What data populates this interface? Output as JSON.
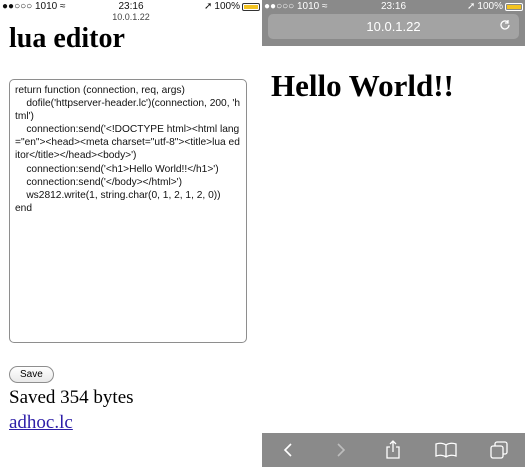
{
  "left": {
    "status": {
      "carrier": "●●○○○ 1010 ≈",
      "time": "23:16",
      "battery_text": "100%",
      "battery_level": 1.0
    },
    "small_url": "10.0.1.22",
    "title": "lua editor",
    "editor_text": "return function (connection, req, args)\n    dofile('httpserver-header.lc')(connection, 200, 'html')\n    connection:send('<!DOCTYPE html><html lang=\"en\"><head><meta charset=\"utf-8\"><title>lua editor</title></head><body>')\n    connection:send('<h1>Hello World!!</h1>')\n    connection:send('</body></html>')\n    ws2812.write(1, string.char(0, 1, 2, 1, 2, 0))\nend",
    "save_label": "Save",
    "saved_text": "Saved 354 bytes",
    "link_text": "adhoc.lc"
  },
  "right": {
    "status": {
      "carrier": "●●○○○ 1010 ≈",
      "time": "23:16",
      "battery_text": "100%",
      "battery_level": 1.0
    },
    "url": "10.0.1.22",
    "heading": "Hello World!!",
    "toolbar": [
      "back-icon",
      "forward-icon",
      "share-icon",
      "bookmarks-icon",
      "tabs-icon"
    ]
  },
  "colors": {
    "chrome_gray": "#8a8a8a",
    "battery_yellow": "#f3c321",
    "link": "#2d1ea8"
  }
}
